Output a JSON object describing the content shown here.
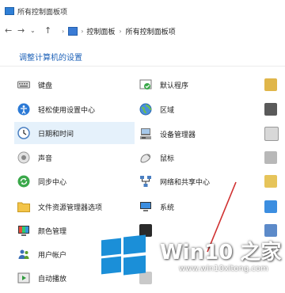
{
  "window": {
    "title": "所有控制面板项"
  },
  "breadcrumb": {
    "items": [
      "控制面板",
      "所有控制面板项"
    ]
  },
  "heading": "调整计算机的设置",
  "col1": [
    {
      "label": "键盘",
      "icon": "keyboard-icon"
    },
    {
      "label": "轻松使用设置中心",
      "icon": "ease-of-access-icon"
    },
    {
      "label": "日期和时间",
      "icon": "clock-icon"
    },
    {
      "label": "声音",
      "icon": "speaker-icon"
    },
    {
      "label": "同步中心",
      "icon": "sync-icon"
    },
    {
      "label": "文件资源管理器选项",
      "icon": "folder-options-icon"
    },
    {
      "label": "颜色管理",
      "icon": "color-management-icon"
    },
    {
      "label": "用户帐户",
      "icon": "user-accounts-icon"
    },
    {
      "label": "自动播放",
      "icon": "autoplay-icon"
    }
  ],
  "col2": [
    {
      "label": "默认程序",
      "icon": "default-programs-icon"
    },
    {
      "label": "区域",
      "icon": "globe-icon"
    },
    {
      "label": "设备管理器",
      "icon": "device-manager-icon"
    },
    {
      "label": "鼠标",
      "icon": "mouse-icon"
    },
    {
      "label": "网络和共享中心",
      "icon": "network-icon"
    },
    {
      "label": "系统",
      "icon": "system-icon"
    }
  ],
  "watermark": {
    "brand": "Win10 之家",
    "url": "www.win10xitong.com"
  }
}
